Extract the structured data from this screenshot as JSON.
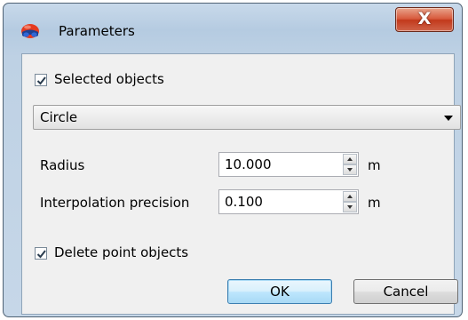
{
  "window": {
    "title": "Parameters",
    "close_label": "X"
  },
  "selected_objects": {
    "label": "Selected objects",
    "checked": true
  },
  "shape": {
    "value": "Circle"
  },
  "radius": {
    "label": "Radius",
    "value": "10.000",
    "unit": "m"
  },
  "interpolation": {
    "label": "Interpolation precision",
    "value": "0.100",
    "unit": "m"
  },
  "delete_points": {
    "label": "Delete point objects",
    "checked": true
  },
  "buttons": {
    "ok": "OK",
    "cancel": "Cancel"
  },
  "colors": {
    "titlebar": "#bfd3e6",
    "close": "#c9452a",
    "client": "#f0f0f0",
    "ok_accent": "#3c7fb1"
  },
  "icons": {
    "app": "red-blue-glasses-icon",
    "check": "checkmark-icon"
  }
}
